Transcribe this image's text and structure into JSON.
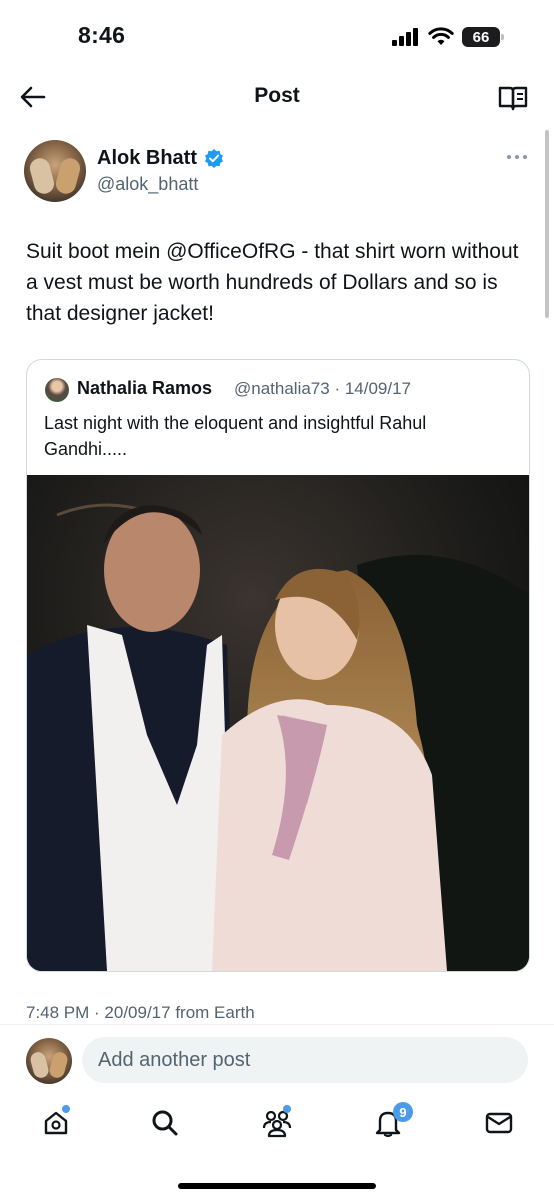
{
  "status_bar": {
    "time": "8:46",
    "battery": "66"
  },
  "header": {
    "title": "Post",
    "back_icon": "arrow-left-icon",
    "reader_icon": "book-open-icon"
  },
  "post": {
    "author_name": "Alok Bhatt",
    "author_handle": "@alok_bhatt",
    "verified": true,
    "text": "Suit boot mein @OfficeOfRG - that shirt worn without a vest must be worth hundreds of Dollars and so is that designer jacket!",
    "timestamp": "7:48 PM · 20/09/17 from Earth",
    "quote": {
      "name": "Nathalia Ramos",
      "meta": "@nathalia73 · 14/09/17",
      "text": "Last night with the eloquent and insightful Rahul Gandhi....."
    }
  },
  "reply": {
    "placeholder": "Add another post"
  },
  "tab_bar": {
    "items": [
      "home-icon",
      "search-icon",
      "communities-icon",
      "notifications-icon",
      "messages-icon"
    ],
    "notifications_count": "9"
  },
  "colors": {
    "accent": "#1d9bf0",
    "text": "#0f1419",
    "secondary": "#536471"
  }
}
